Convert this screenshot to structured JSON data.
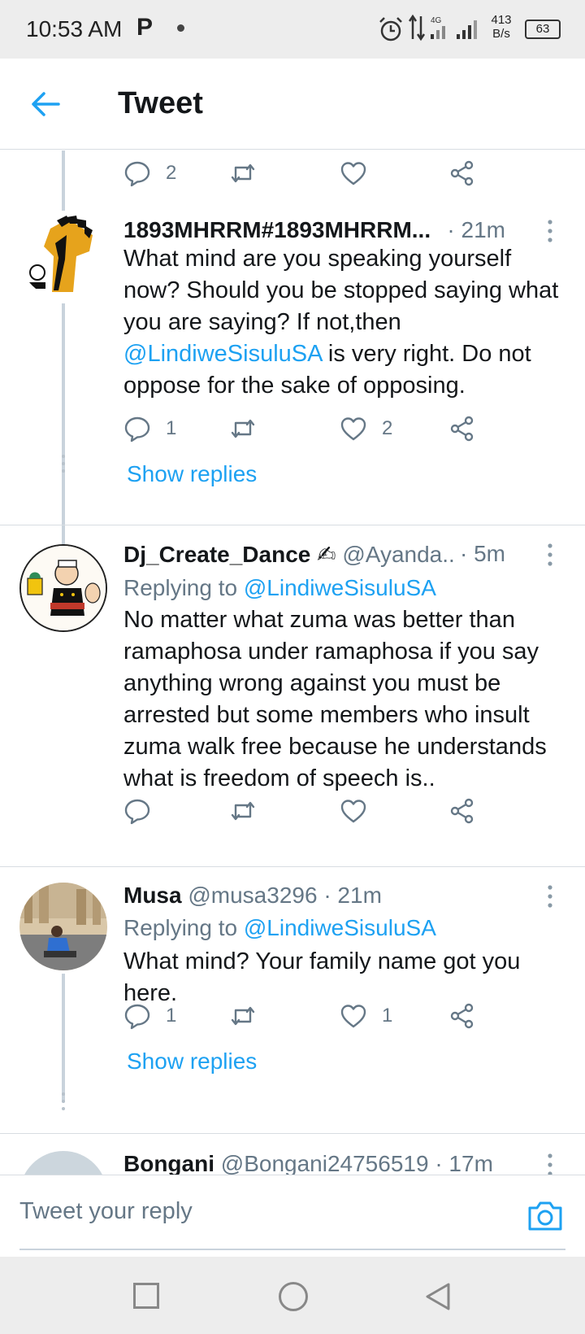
{
  "status_bar": {
    "time": "10:53 AM",
    "notification_icon": "P",
    "network": "4G",
    "speed_value": "413",
    "speed_unit": "B/s",
    "battery": "63"
  },
  "app_bar": {
    "title": "Tweet"
  },
  "top_actions": {
    "reply_count": "2",
    "retweet_count": "",
    "like_count": ""
  },
  "tweets": [
    {
      "name": "1893MHRRM#1893MHRRM...",
      "handle": "",
      "time": "· 21m",
      "replying_label": "",
      "replying_to": "",
      "text_parts": [
        "What mind are you speaking yourself now? Should you be stopped saying what you are saying? If not,then ",
        "@LindiweSisuluSA",
        "  is very right. Do not oppose for the sake of opposing."
      ],
      "reply_count": "1",
      "retweet_count": "",
      "like_count": "2",
      "show_replies": "Show replies"
    },
    {
      "name": "Dj_Create_Dance ✍",
      "handle": "@Ayanda...",
      "time": "· 5m",
      "replying_label": "Replying to",
      "replying_to": "@LindiweSisuluSA",
      "text": "No matter what zuma was better than ramaphosa under ramaphosa if you say anything wrong against you must be arrested but some members who insult zuma walk free because he understands what is freedom of speech is..",
      "reply_count": "",
      "retweet_count": "",
      "like_count": ""
    },
    {
      "name": "Musa",
      "handle": "@musa3296",
      "time": "· 21m",
      "replying_label": "Replying to",
      "replying_to": "@LindiweSisuluSA",
      "text": "What mind? Your family name got you here.",
      "reply_count": "1",
      "retweet_count": "",
      "like_count": "1",
      "show_replies": "Show replies"
    },
    {
      "name": "Bongani",
      "handle": "@Bongani24756519",
      "time": "· 17m"
    }
  ],
  "composer": {
    "placeholder": "Tweet your reply"
  },
  "colors": {
    "accent": "#1da1f2",
    "secondary_text": "#657786",
    "divider": "#d8dde2"
  }
}
